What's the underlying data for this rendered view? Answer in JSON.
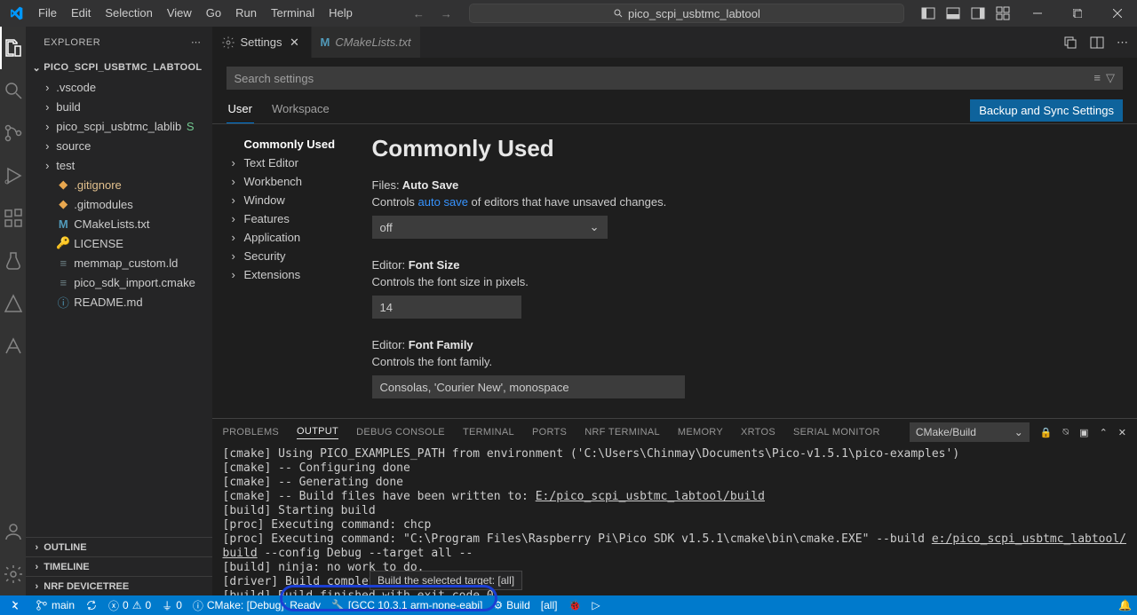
{
  "menu": [
    "File",
    "Edit",
    "Selection",
    "View",
    "Go",
    "Run",
    "Terminal",
    "Help"
  ],
  "titleSearch": "pico_scpi_usbtmc_labtool",
  "explorer": {
    "title": "EXPLORER",
    "project": "PICO_SCPI_USBTMC_LABTOOL",
    "items": [
      {
        "kind": "folder",
        "label": ".vscode"
      },
      {
        "kind": "folder",
        "label": "build"
      },
      {
        "kind": "folder",
        "label": "pico_scpi_usbtmc_lablib",
        "git": "sub",
        "status": "S"
      },
      {
        "kind": "folder",
        "label": "source"
      },
      {
        "kind": "folder",
        "label": "test"
      },
      {
        "kind": "file",
        "label": ".gitignore",
        "icon": "git",
        "git": "mod"
      },
      {
        "kind": "file",
        "label": ".gitmodules",
        "icon": "git"
      },
      {
        "kind": "file",
        "label": "CMakeLists.txt",
        "icon": "cmake"
      },
      {
        "kind": "file",
        "label": "LICENSE",
        "icon": "license"
      },
      {
        "kind": "file",
        "label": "memmap_custom.ld",
        "icon": "generic"
      },
      {
        "kind": "file",
        "label": "pico_sdk_import.cmake",
        "icon": "generic"
      },
      {
        "kind": "file",
        "label": "README.md",
        "icon": "info"
      }
    ],
    "sections": [
      "OUTLINE",
      "TIMELINE",
      "NRF DEVICETREE"
    ]
  },
  "tabs": {
    "items": [
      {
        "label": "Settings",
        "icon": "gear",
        "active": true
      },
      {
        "label": "CMakeLists.txt",
        "icon": "cmake",
        "active": false
      }
    ]
  },
  "settings": {
    "searchPlaceholder": "Search settings",
    "scopes": [
      "User",
      "Workspace"
    ],
    "backup": "Backup and Sync Settings",
    "toc": [
      "Commonly Used",
      "Text Editor",
      "Workbench",
      "Window",
      "Features",
      "Application",
      "Security",
      "Extensions"
    ],
    "heading": "Commonly Used",
    "autoSave": {
      "prefix": "Files:",
      "title": "Auto Save",
      "desc1": "Controls ",
      "link": "auto save",
      "desc2": " of editors that have unsaved changes.",
      "value": "off"
    },
    "fontSize": {
      "prefix": "Editor:",
      "title": "Font Size",
      "desc": "Controls the font size in pixels.",
      "value": "14"
    },
    "fontFamily": {
      "prefix": "Editor:",
      "title": "Font Family",
      "desc": "Controls the font family.",
      "value": "Consolas, 'Courier New', monospace"
    }
  },
  "panel": {
    "tabs": [
      "PROBLEMS",
      "OUTPUT",
      "DEBUG CONSOLE",
      "TERMINAL",
      "PORTS",
      "NRF TERMINAL",
      "MEMORY",
      "XRTOS",
      "SERIAL MONITOR"
    ],
    "active": 1,
    "channel": "CMake/Build",
    "lines": [
      "[cmake] Using PICO_EXAMPLES_PATH from environment ('C:\\Users\\Chinmay\\Documents\\Pico-v1.5.1\\pico-examples')",
      "[cmake] -- Configuring done",
      "[cmake] -- Generating done",
      "[cmake] -- Build files have been written to: E:/pico_scpi_usbtmc_labtool/build",
      "[build] Starting build",
      "[proc] Executing command: chcp",
      "[proc] Executing command: \"C:\\Program Files\\Raspberry Pi\\Pico SDK v1.5.1\\cmake\\bin\\cmake.EXE\" --build e:/pico_scpi_usbtmc_labtool/build --config Debug --target all --",
      "[build] ninja: no work to do.",
      "[driver] Build completed: 00:00:00.114",
      "[build] Build finished with exit code 0"
    ]
  },
  "tooltip": "Build the selected target: [all]",
  "status": {
    "branch": "main",
    "errors": "0",
    "warnings": "0",
    "ports": "0",
    "cmake": "CMake: [Debug]: Ready",
    "kit": "[GCC 10.3.1 arm-none-eabi]",
    "build": "Build",
    "target": "[all]"
  }
}
